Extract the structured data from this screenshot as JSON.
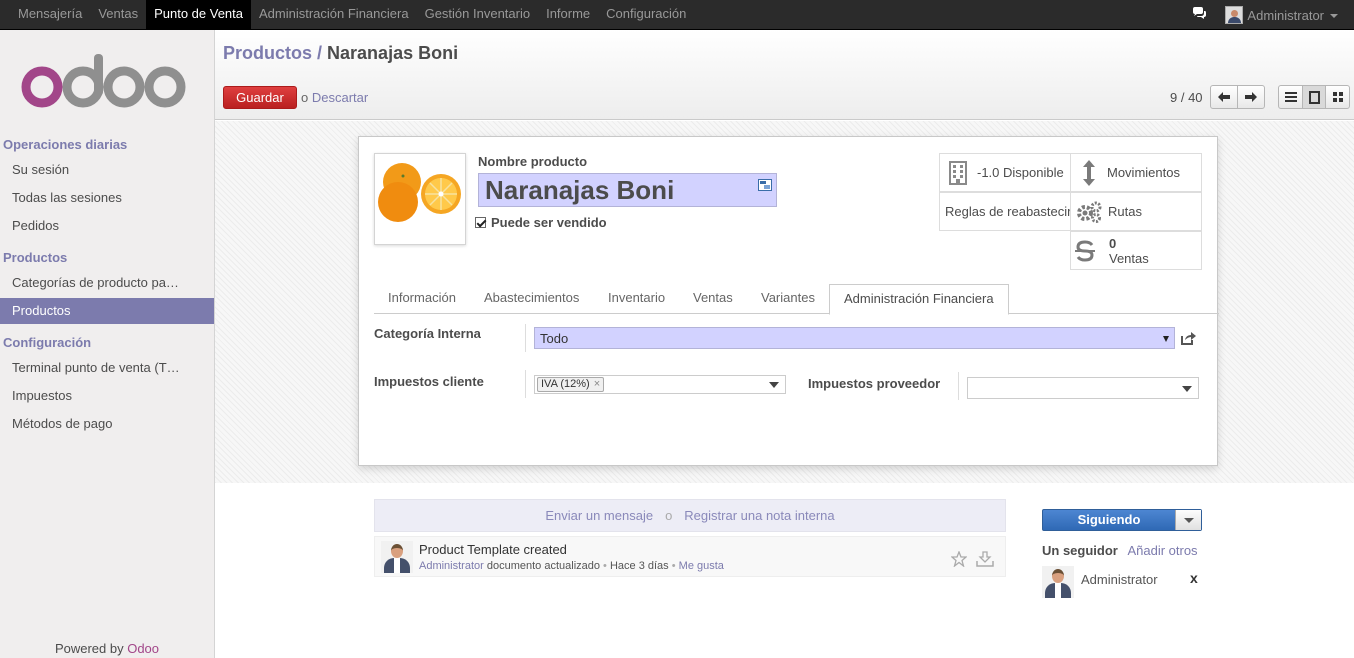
{
  "topbar": {
    "menu": [
      "Mensajería",
      "Ventas",
      "Punto de Venta",
      "Administración Financiera",
      "Gestión Inventario",
      "Informe",
      "Configuración"
    ],
    "active_index": 2,
    "user": "Administrator"
  },
  "sidebar": {
    "logo": "odoo",
    "sections": [
      {
        "title": "Operaciones diarias",
        "items": [
          "Su sesión",
          "Todas las sesiones",
          "Pedidos"
        ]
      },
      {
        "title": "Productos",
        "items": [
          "Categorías de producto pa…",
          "Productos"
        ]
      },
      {
        "title": "Configuración",
        "items": [
          "Terminal punto de venta (T…",
          "Impuestos",
          "Métodos de pago"
        ]
      }
    ],
    "active_item": "Productos",
    "powered_prefix": "Powered by ",
    "powered_brand": "Odoo"
  },
  "header": {
    "breadcrumb_parent": "Productos",
    "breadcrumb_sep": " / ",
    "breadcrumb_current": "Naranajas Boni",
    "save_label": "Guardar",
    "or_label": "o ",
    "discard_label": "Descartar",
    "pager": "9 / 40"
  },
  "form": {
    "name_label": "Nombre producto",
    "name_value": "Naranajas Boni",
    "sale_ok_label": "Puede ser vendido",
    "sale_ok_checked": true,
    "stats": {
      "available": "-1.0 Disponible",
      "moves": "Movimientos",
      "reorder": "Reglas de reabastecimiento",
      "routes": "Rutas",
      "sales_count": "0",
      "sales_label": "Ventas"
    },
    "tabs": [
      "Información",
      "Abastecimientos",
      "Inventario",
      "Ventas",
      "Variantes",
      "Administración Financiera"
    ],
    "active_tab": "Administración Financiera",
    "categ_label": "Categoría Interna",
    "categ_value": "Todo",
    "customer_taxes_label": "Impuestos cliente",
    "customer_tax_tag": "IVA (12%)",
    "supplier_taxes_label": "Impuestos proveedor",
    "supplier_taxes_value": ""
  },
  "chatter": {
    "send_message": "Enviar un mensaje",
    "or": "o",
    "log_note": "Registrar una nota interna",
    "message_title": "Product Template created",
    "message_author": "Administrator",
    "message_action": " documento actualizado",
    "message_time": "Hace 3 días",
    "message_like": "Me gusta",
    "follow_label": "Siguiendo",
    "followers_label": "Un seguidor",
    "add_followers": "Añadir otros",
    "follower_name": "Administrator",
    "remove_label": "x"
  },
  "colors": {
    "accent": "#7c7bad",
    "save": "#c9272b",
    "required_field": "#d2d2ff",
    "follow": "#3a75c4",
    "brand": "#a24689"
  }
}
